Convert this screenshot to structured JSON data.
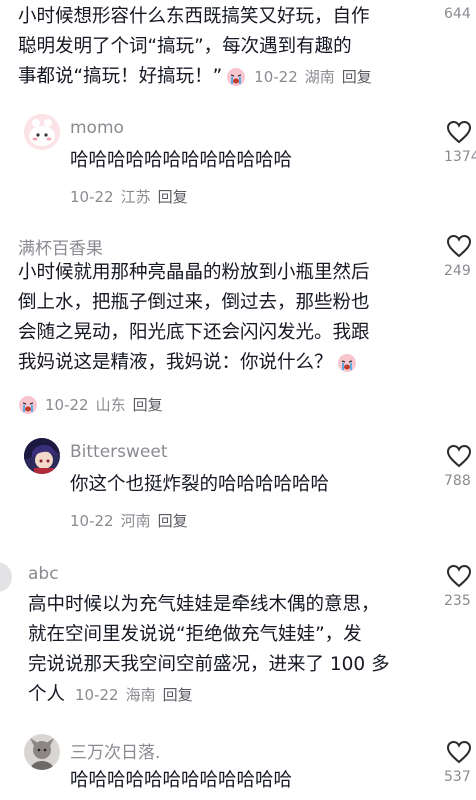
{
  "comments": [
    {
      "lines": [
        "小时候想形容什么东西既搞笑又好玩，自作",
        "聪明发明了个词“搞玩”，每次遇到有趣的",
        "事都说“搞玩！好搞玩！”"
      ],
      "date": "10-22",
      "location": "湖南",
      "reply": "回复",
      "likes": "644"
    },
    {
      "username": "momo",
      "lines": [
        "哈哈哈哈哈哈哈哈哈哈哈哈"
      ],
      "date": "10-22",
      "location": "江苏",
      "reply": "回复",
      "likes": "1374"
    },
    {
      "username": "满杯百香果",
      "lines": [
        "小时候就用那种亮晶晶的粉放到小瓶里然后",
        "倒上水，把瓶子倒过来，倒过去，那些粉也",
        "会随之晃动，阳光底下还会闪闪发光。我跟",
        "我妈说这是精液，我妈说：你说什么？"
      ],
      "date": "10-22",
      "location": "山东",
      "reply": "回复",
      "likes": "249"
    },
    {
      "username": "Bittersweet",
      "lines": [
        "你这个也挺炸裂的哈哈哈哈哈哈"
      ],
      "date": "10-22",
      "location": "河南",
      "reply": "回复",
      "likes": "788"
    },
    {
      "username": "abc",
      "lines": [
        "高中时候以为充气娃娃是牵线木偶的意思，",
        "就在空间里发说说“拒绝做充气娃娃”，发",
        "完说说那天我空间空前盛况，进来了 100 多",
        "个人"
      ],
      "date": "10-22",
      "location": "海南",
      "reply": "回复",
      "likes": "235"
    },
    {
      "username": "三万次日落.",
      "lines": [
        "哈哈哈哈哈哈哈哈哈哈哈哈"
      ],
      "likes": "537"
    }
  ],
  "icons": {
    "like": "heart-outline-icon",
    "crying_emoji": "crying-face-emoji-icon"
  },
  "colors": {
    "text": "#161823",
    "muted": "#8a8b91",
    "reply": "#5a5b62"
  }
}
